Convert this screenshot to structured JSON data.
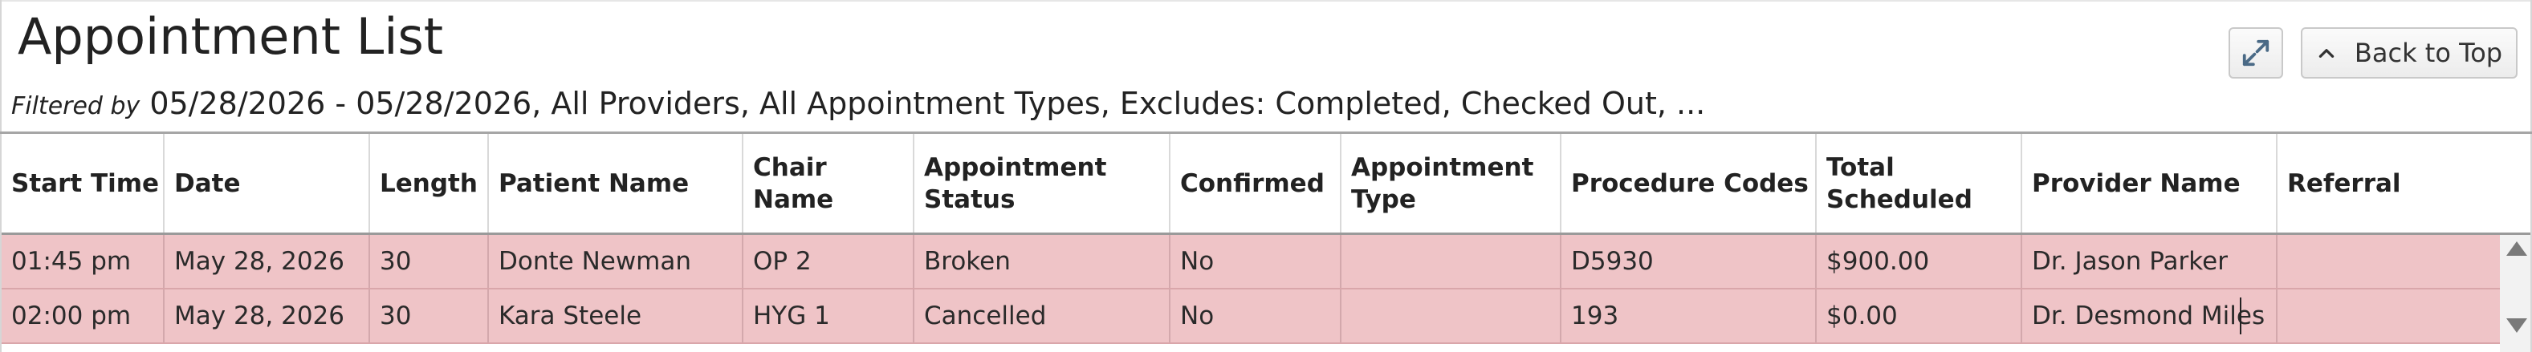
{
  "page": {
    "title": "Appointment List",
    "filter_label": "Filtered by",
    "filter_text": "05/28/2026 - 05/28/2026, All Providers, All Appointment Types, Excludes: Completed, Checked Out, ..."
  },
  "toolbar": {
    "expand_icon": "expand-icon",
    "back_to_top_label": "Back to Top",
    "back_to_top_icon": "chevron-up-icon"
  },
  "table": {
    "columns": [
      "Start Time",
      "Date",
      "Length",
      "Patient Name",
      "Chair Name",
      "Appointment Status",
      "Confirmed",
      "Appointment Type",
      "Procedure Codes",
      "Total Scheduled",
      "Provider Name",
      "Referral"
    ],
    "rows": [
      [
        "01:45 pm",
        "May 28, 2026",
        "30",
        "Donte Newman",
        "OP 2",
        "Broken",
        "No",
        "",
        "D5930",
        "$900.00",
        "Dr. Jason Parker",
        ""
      ],
      [
        "02:00 pm",
        "May 28, 2026",
        "30",
        "Kara Steele",
        "HYG 1",
        "Cancelled",
        "No",
        "",
        "193",
        "$0.00",
        "Dr. Desmond Miles",
        ""
      ]
    ],
    "row_color": "#efc4c7"
  }
}
